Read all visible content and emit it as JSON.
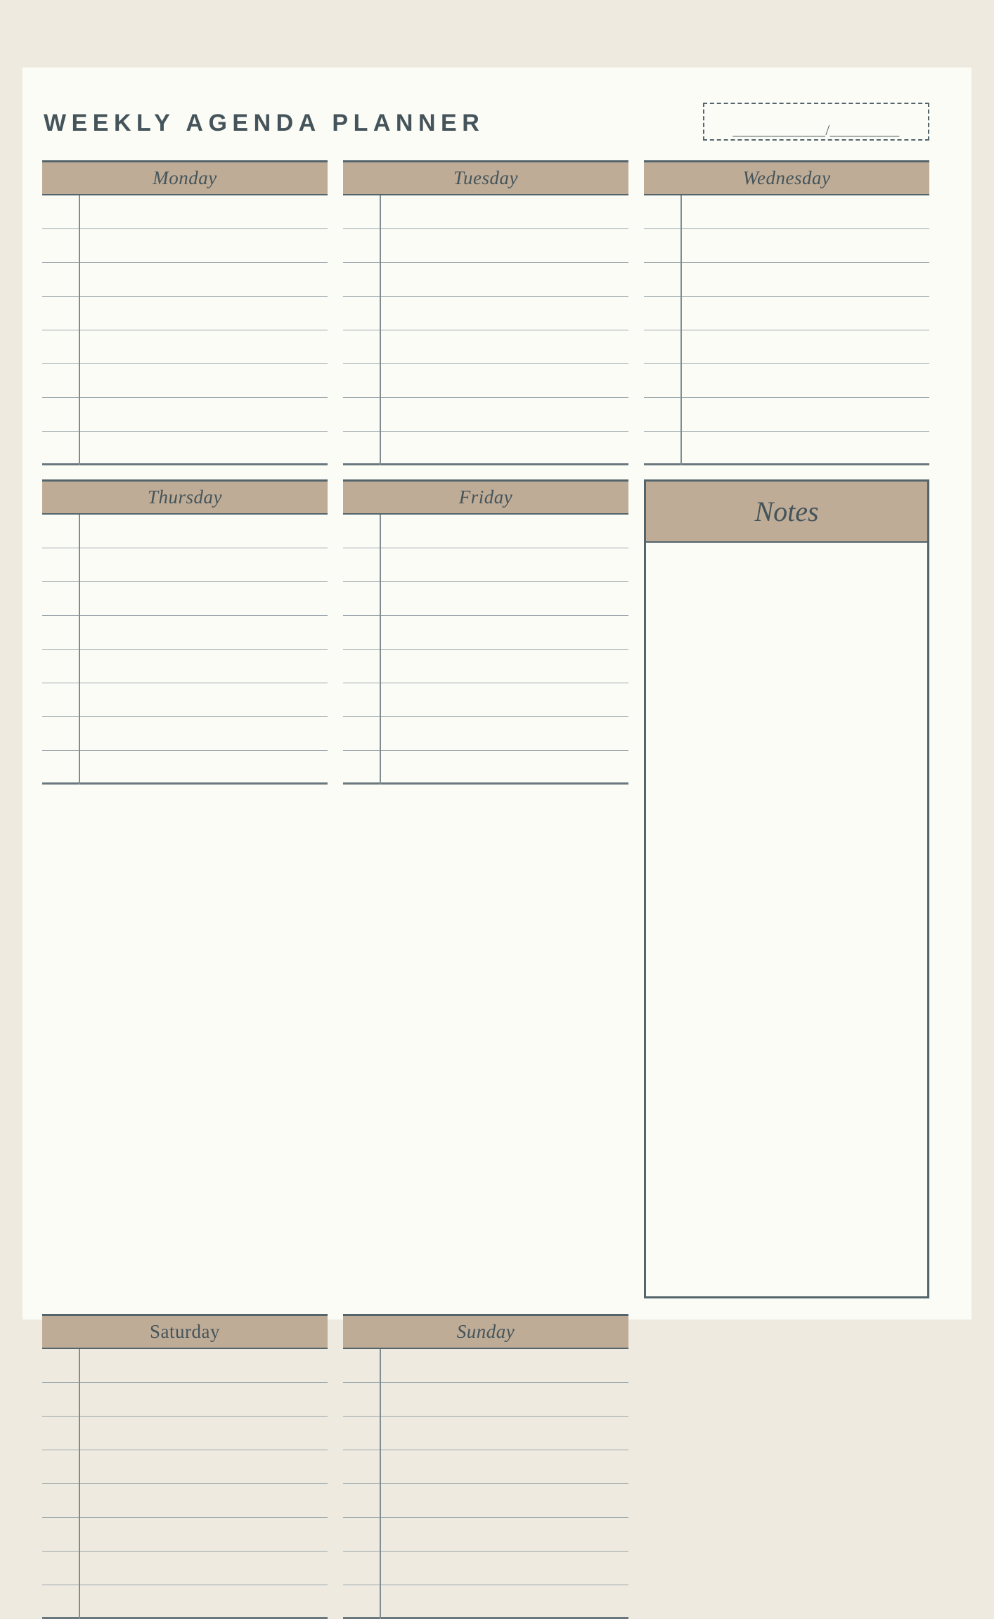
{
  "page": {
    "title": "WEEKLY AGENDA PLANNER",
    "background_color": "#EEEAE0",
    "sheet_color": "#FCFCF7",
    "accent_color": "#BFAC97",
    "ink_color": "#44545A",
    "rule_color": "#9AA6AA"
  },
  "date_field": {
    "value": "____________/_________",
    "placeholder": "____________/_________"
  },
  "days": [
    {
      "label": "Monday",
      "lines": 9,
      "style": "italic"
    },
    {
      "label": "Tuesday",
      "lines": 9,
      "style": "italic"
    },
    {
      "label": "Wednesday",
      "lines": 9,
      "style": "italic"
    },
    {
      "label": "Thursday",
      "lines": 8,
      "style": "italic"
    },
    {
      "label": "Friday",
      "lines": 8,
      "style": "italic"
    },
    {
      "label": "Saturday",
      "lines": 8,
      "style": "upright"
    },
    {
      "label": "Sunday",
      "lines": 8,
      "style": "italic"
    }
  ],
  "notes": {
    "label": "Notes",
    "content": ""
  }
}
